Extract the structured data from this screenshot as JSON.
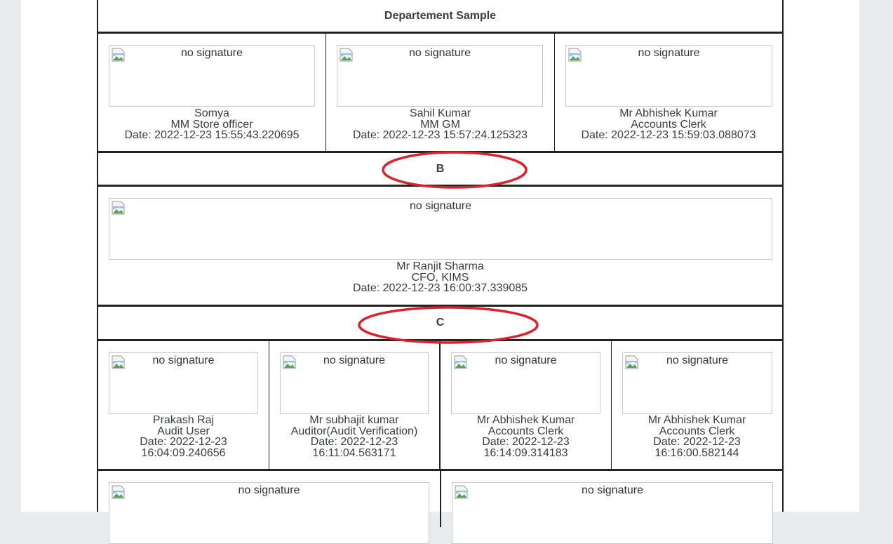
{
  "sections": {
    "departement": {
      "title": "Departement Sample",
      "signers": [
        {
          "alt": "no signature",
          "name": "Somya",
          "role": "MM Store officer",
          "date": "Date: 2022-12-23 15:55:43.220695"
        },
        {
          "alt": "no signature",
          "name": "Sahil Kumar",
          "role": "MM GM",
          "date": "Date: 2022-12-23 15:57:24.125323"
        },
        {
          "alt": "no signature",
          "name": "Mr Abhishek Kumar",
          "role": "Accounts Clerk",
          "date": "Date: 2022-12-23 15:59:03.088073"
        }
      ]
    },
    "b": {
      "title": "B",
      "signers": [
        {
          "alt": "no signature",
          "name": "Mr Ranjit Sharma",
          "role": "CFO, KIMS",
          "date": "Date: 2022-12-23 16:00:37.339085"
        }
      ]
    },
    "c": {
      "title": "C",
      "signers": [
        {
          "alt": "no signature",
          "name": "Prakash Raj",
          "role": "Audit User",
          "date": "Date: 2022-12-23",
          "time": "16:04:09.240656"
        },
        {
          "alt": "no signature",
          "name": "Mr subhajit kumar",
          "role": "Auditor(Audit Verification)",
          "date": "Date: 2022-12-23",
          "time": "16:11:04.563171"
        },
        {
          "alt": "no signature",
          "name": "Mr Abhishek Kumar",
          "role": "Accounts Clerk",
          "date": "Date: 2022-12-23",
          "time": "16:14:09.314183"
        },
        {
          "alt": "no signature",
          "name": "Mr Abhishek Kumar",
          "role": "Accounts Clerk",
          "date": "Date: 2022-12-23",
          "time": "16:16:00.582144"
        }
      ]
    },
    "d": {
      "signers": [
        {
          "alt": "no signature"
        },
        {
          "alt": "no signature"
        }
      ]
    }
  },
  "annotation_color": "#d9232d"
}
